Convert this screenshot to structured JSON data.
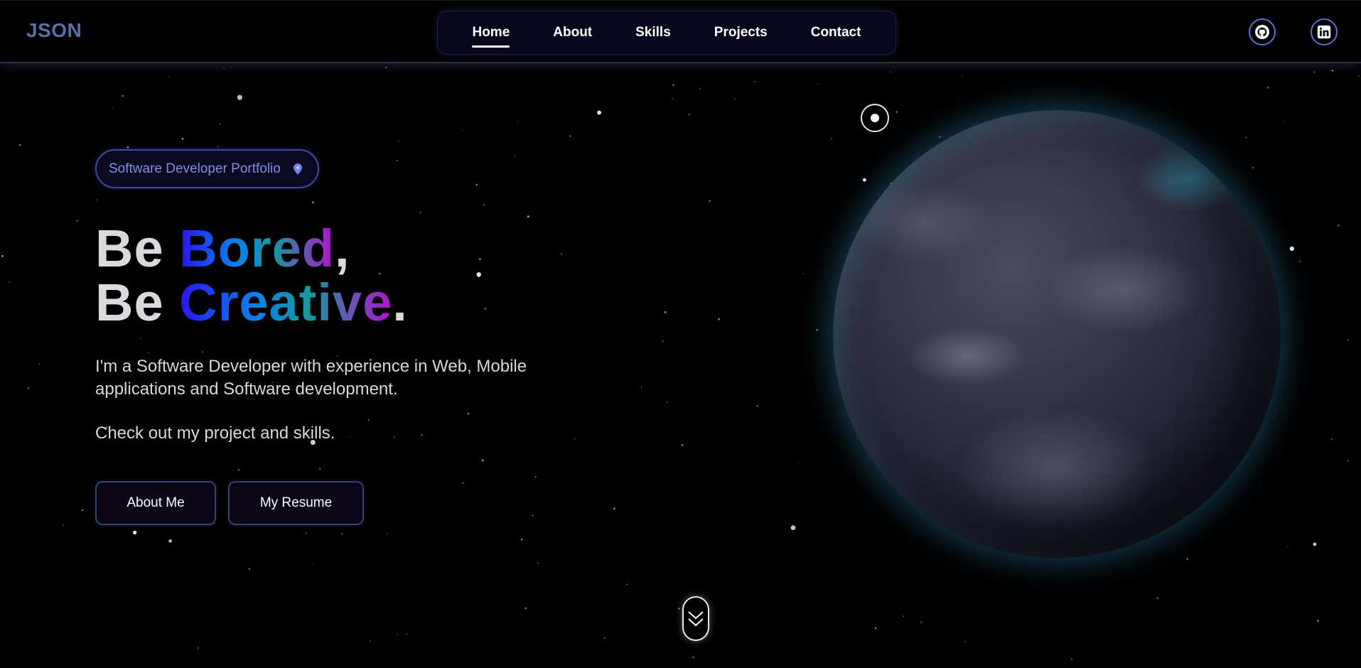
{
  "header": {
    "brand": "JSON",
    "nav": [
      {
        "label": "Home",
        "active": true
      },
      {
        "label": "About",
        "active": false
      },
      {
        "label": "Skills",
        "active": false
      },
      {
        "label": "Projects",
        "active": false
      },
      {
        "label": "Contact",
        "active": false
      }
    ],
    "social": [
      {
        "icon": "github-icon"
      },
      {
        "icon": "linkedin-icon"
      }
    ]
  },
  "hero": {
    "badge": {
      "label": "Software Developer Portfolio",
      "icon": "pin-icon"
    },
    "headline": {
      "line1_prefix": "Be ",
      "line1_highlight": "Bored",
      "line1_suffix": ",",
      "line2_prefix": "Be ",
      "line2_highlight": "Creative",
      "line2_suffix": "."
    },
    "description": "I'm a Software Developer with experience in Web, Mobile applications and Software development.",
    "description2": "Check out my project and skills.",
    "buttons": {
      "about": "About Me",
      "resume": "My Resume"
    }
  },
  "colors": {
    "background": "#000000",
    "brand": "#5a6fa8",
    "accent": "#5b6fd0",
    "badge_text": "#7f8fe6",
    "gradient": [
      "#2a13f0",
      "#0a7ff0",
      "#139a9f",
      "#b313c9"
    ]
  },
  "icons": {
    "globe": "earth-globe",
    "orbit": "radio-dot-icon",
    "scroll": "double-chevron-down-icon"
  }
}
